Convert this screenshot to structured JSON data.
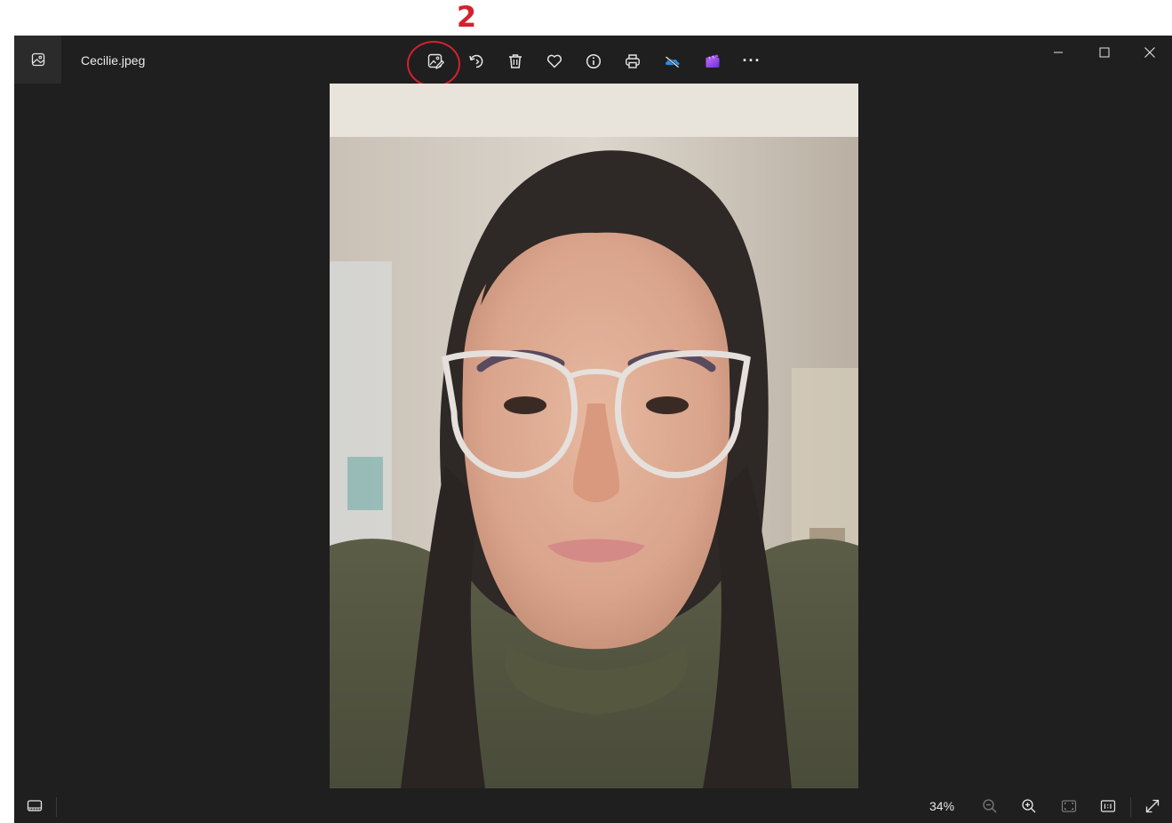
{
  "annotation": {
    "number": "2",
    "color": "#d6202e"
  },
  "titlebar": {
    "filename": "Cecilie.jpeg",
    "app_icon": "photos-app-icon"
  },
  "toolbar": {
    "buttons": [
      {
        "name": "edit-image-button",
        "icon": "edit-image-icon",
        "highlighted": true
      },
      {
        "name": "rotate-button",
        "icon": "rotate-icon"
      },
      {
        "name": "delete-button",
        "icon": "trash-icon"
      },
      {
        "name": "favorite-button",
        "icon": "heart-icon"
      },
      {
        "name": "info-button",
        "icon": "info-icon"
      },
      {
        "name": "print-button",
        "icon": "printer-icon"
      },
      {
        "name": "onedrive-button",
        "icon": "onedrive-off-icon"
      },
      {
        "name": "clipchamp-button",
        "icon": "clipchamp-icon"
      },
      {
        "name": "more-options-button",
        "icon": "more-icon",
        "label": "···"
      }
    ]
  },
  "window_controls": [
    "minimize",
    "maximize",
    "close"
  ],
  "bottombar": {
    "zoom_level": "34%",
    "buttons": [
      "filmstrip",
      "zoom-out",
      "zoom-in",
      "fit-to-window",
      "actual-size",
      "full-screen"
    ]
  },
  "colors": {
    "window_bg": "#1f1f1f",
    "icon": "#e6e6e6",
    "onedrive_blue": "#2c8ee8",
    "clipchamp_purple": "#8a43e8"
  }
}
